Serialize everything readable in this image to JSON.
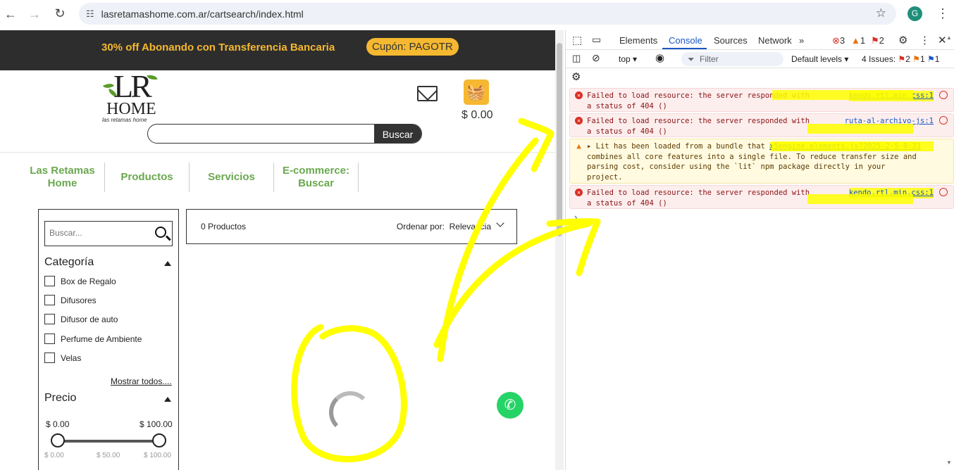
{
  "browser": {
    "url": "lasretamashome.com.ar/cartsearch/index.html",
    "profile_initial": "G"
  },
  "promo": {
    "text": "30% off Abonando con Transferencia Bancaria",
    "coupon": "Cupón: PAGOTR"
  },
  "logo": {
    "mark": "LR",
    "word": "HOME",
    "tagline": "las retamas home"
  },
  "header_search": {
    "button": "Buscar"
  },
  "cart": {
    "total": "$ 0.00"
  },
  "menu": [
    {
      "label": "Las Retamas Home"
    },
    {
      "label": "Productos"
    },
    {
      "label": "Servicios"
    },
    {
      "label": "E-commerce: Buscar"
    }
  ],
  "filters": {
    "search_placeholder": "Buscar...",
    "category_title": "Categoría",
    "categories": [
      "Box de Regalo",
      "Difusores",
      "Difusor de auto",
      "Perfume de Ambiente",
      "Velas"
    ],
    "show_all": "Mostrar todos....",
    "price_title": "Precio",
    "price_min": "$ 0.00",
    "price_max": "$ 100.00",
    "price_ticks": [
      "$ 0.00",
      "$ 50.00",
      "$ 100.00"
    ]
  },
  "results": {
    "count": "0 Productos",
    "order_label": "Ordenar por:",
    "order_value": "Relevancia"
  },
  "devtools": {
    "tabs": [
      "Elements",
      "Console",
      "Sources",
      "Network"
    ],
    "active_tab": "Console",
    "counts": {
      "errors": "3",
      "warnings": "1",
      "issues_badge": "2"
    },
    "context": "top",
    "filter_placeholder": "Filter",
    "levels": "Default levels",
    "issues_label": "4 Issues:",
    "issue_counts": [
      "2",
      "1",
      "1"
    ],
    "messages": [
      {
        "type": "error",
        "line1": "Failed to load resource: the server responded with",
        "line2": "a status of 404 ()",
        "source": "kendo.rtl.min.css:1"
      },
      {
        "type": "error",
        "line1": "Failed to load resource: the server responded with",
        "line2": "a status of 404 ()",
        "source": "ruta-al-archivo-js:1"
      },
      {
        "type": "warning",
        "line1": "Lit has been loaded from a bundle that",
        "source": "x5engine.elements.js?2025-2-5-0:31",
        "line2": "combines all core features into a single file. To reduce transfer size and",
        "line3": "parsing cost, consider using the `lit` npm package directly in your",
        "line4": "project."
      },
      {
        "type": "error",
        "line1": "Failed to load resource: the server responded with",
        "line2": "a status of 404 ()",
        "source": "kendo.rtl.min.css:1"
      }
    ]
  },
  "colors": {
    "accent": "#f5b830",
    "menu_green": "#6aa84f",
    "annotation": "#ffff00",
    "devtools_blue": "#1a56c4"
  }
}
